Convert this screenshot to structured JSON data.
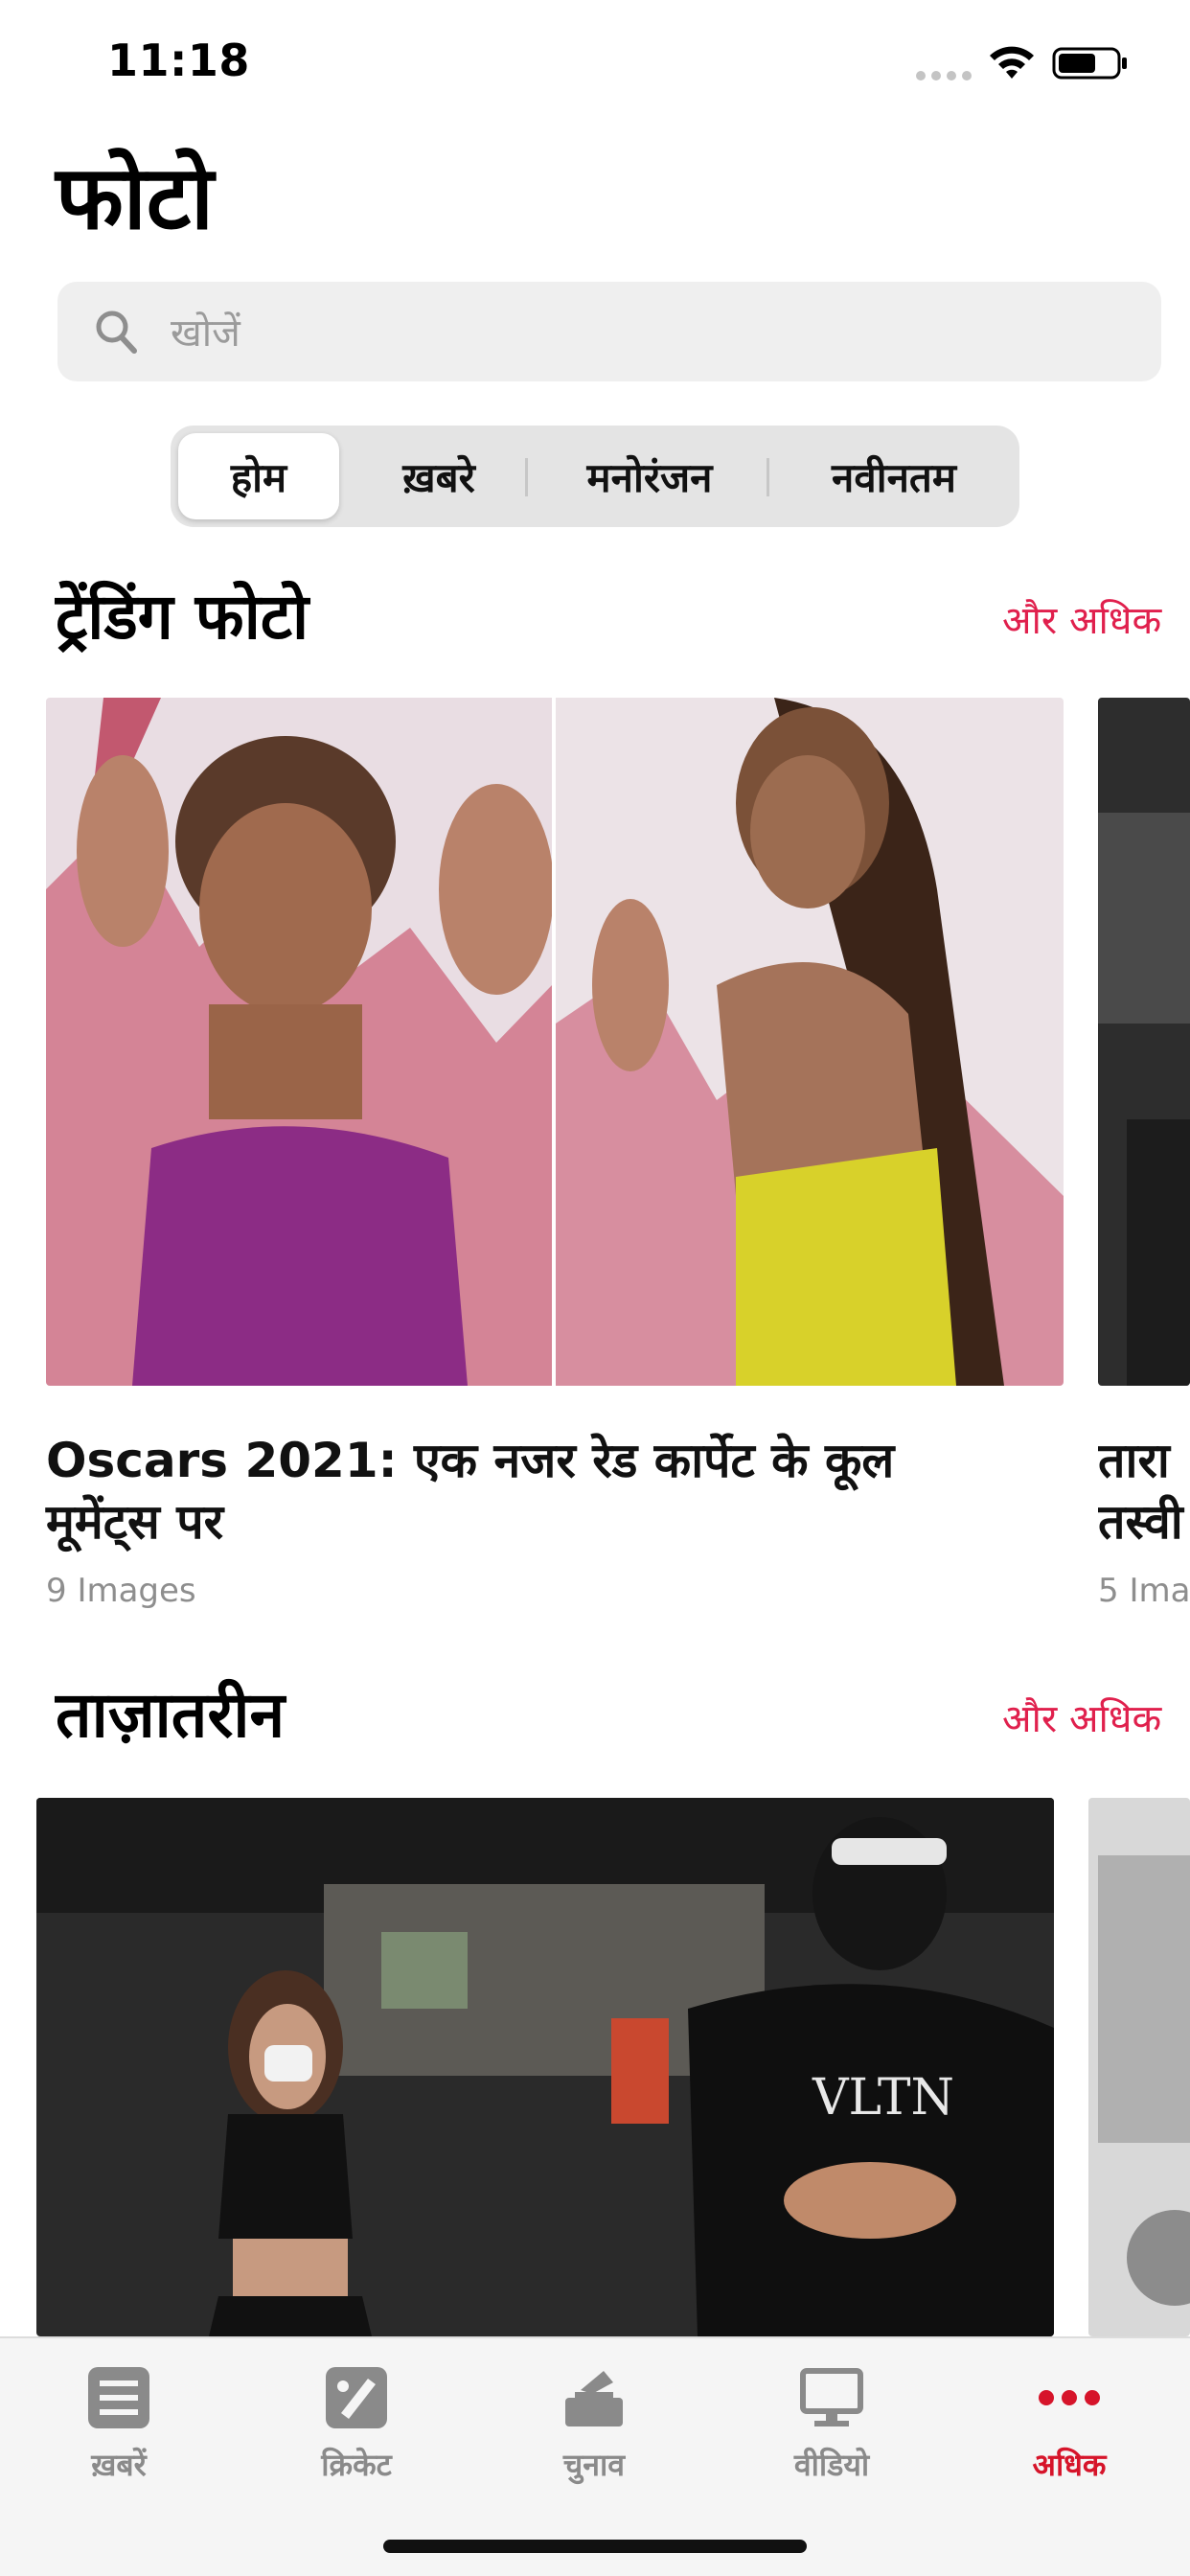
{
  "status_bar": {
    "time": "11:18"
  },
  "header": {
    "title": "फोटो"
  },
  "search": {
    "placeholder": "खोजें"
  },
  "segments": [
    {
      "label": "होम",
      "active": true
    },
    {
      "label": "ख़बरे",
      "active": false
    },
    {
      "label": "मनोरंजन",
      "active": false
    },
    {
      "label": "नवीनतम",
      "active": false
    }
  ],
  "trending": {
    "title": "ट्रेंडिंग फोटो",
    "more_label": "और अधिक",
    "cards": [
      {
        "title_line1": "Oscars 2021: एक नजर रेड कार्पेट के कूल",
        "title_line2": "मूमेंट्स पर",
        "count": "9 Images"
      },
      {
        "title_line1": "तारा",
        "title_line2": "तस्वी",
        "count": "5 Imag"
      }
    ]
  },
  "latest": {
    "title": "ताज़ातरीन",
    "more_label": "और अधिक"
  },
  "tab_bar": {
    "items": [
      {
        "label": "ख़बरें",
        "icon": "news-icon",
        "active": false
      },
      {
        "label": "क्रिकेट",
        "icon": "cricket-icon",
        "active": false
      },
      {
        "label": "चुनाव",
        "icon": "election-icon",
        "active": false
      },
      {
        "label": "वीडियो",
        "icon": "video-icon",
        "active": false
      },
      {
        "label": "अधिक",
        "icon": "more-icon",
        "active": true
      }
    ]
  },
  "colors": {
    "accent": "#e0204d",
    "tab_active": "#d6142a"
  }
}
